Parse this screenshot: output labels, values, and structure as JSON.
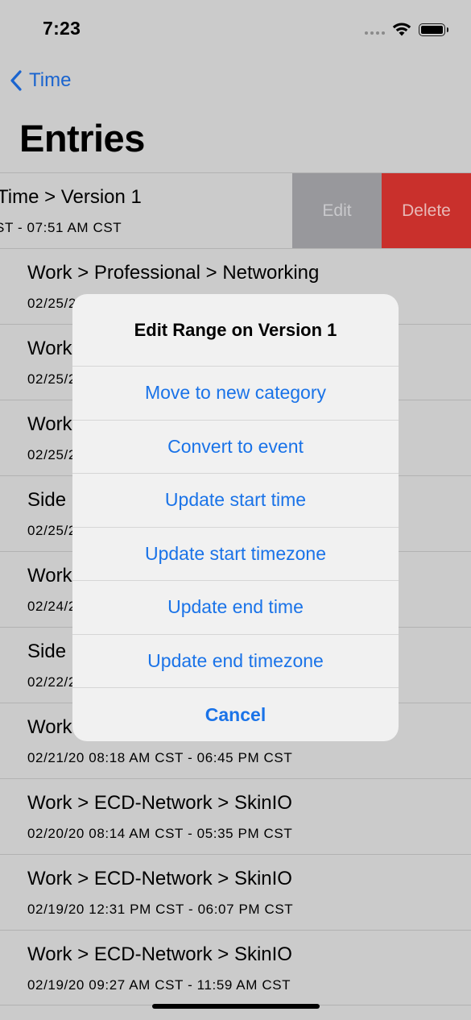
{
  "status": {
    "time": "7:23"
  },
  "nav": {
    "back_label": "Time",
    "title": "Entries"
  },
  "swipe_actions": {
    "edit": "Edit",
    "delete": "Delete"
  },
  "rows": [
    {
      "path": "Time > Version 1",
      "range": "ST - 07:51 AM CST"
    },
    {
      "path": "Work > Professional > Networking",
      "range": "02/25/20"
    },
    {
      "path": "Work",
      "range": "02/25/20"
    },
    {
      "path": "Work",
      "range": "02/25/20"
    },
    {
      "path": "Side",
      "range": "02/25/20"
    },
    {
      "path": "Work",
      "range": "02/24/20"
    },
    {
      "path": "Side",
      "range": "02/22/20"
    },
    {
      "path": "Work",
      "range": "02/21/20 08:18 AM CST - 06:45 PM CST"
    },
    {
      "path": "Work > ECD-Network > SkinIO",
      "range": "02/20/20 08:14 AM CST - 05:35 PM CST"
    },
    {
      "path": "Work > ECD-Network > SkinIO",
      "range": "02/19/20 12:31 PM CST - 06:07 PM CST"
    },
    {
      "path": "Work > ECD-Network > SkinIO",
      "range": "02/19/20 09:27 AM CST - 11:59 AM CST"
    }
  ],
  "alert": {
    "title": "Edit Range on Version 1",
    "options": [
      "Move to new category",
      "Convert to event",
      "Update start time",
      "Update start timezone",
      "Update end time",
      "Update end timezone"
    ],
    "cancel": "Cancel"
  },
  "colors": {
    "accent": "#1a73e8",
    "delete": "#c9302c",
    "edit": "#98989c"
  },
  "icons": {
    "back": "chevron-left-icon",
    "wifi": "wifi-icon",
    "battery": "battery-icon",
    "signal": "cellular-signal-icon"
  }
}
